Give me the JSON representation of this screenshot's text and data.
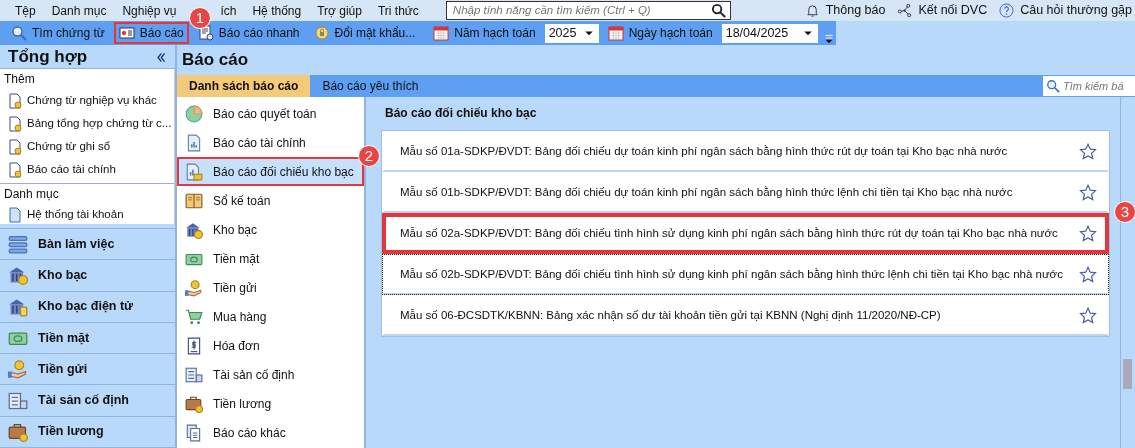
{
  "menu": [
    "Tệp",
    "Danh mục",
    "Nghiệp vụ",
    "ích",
    "Hệ thống",
    "Trợ giúp",
    "Tri thức"
  ],
  "global_search": {
    "placeholder": "Nhập tính năng cần tìm kiếm (Ctrl + Q)"
  },
  "top_links": [
    "Thông báo",
    "Kết nối DVC",
    "Câu hỏi thường gặp"
  ],
  "toolbar": {
    "buttons": [
      {
        "label": "Tìm chứng từ",
        "highlighted": false
      },
      {
        "label": "Báo cáo",
        "highlighted": true,
        "callout": "1"
      },
      {
        "label": "Báo cáo nhanh",
        "highlighted": false
      },
      {
        "label": "Đổi mật khẩu...",
        "highlighted": false
      }
    ],
    "year": {
      "label": "Năm hạch toán",
      "value": "2025"
    },
    "date": {
      "label": "Ngày hạch toán",
      "value": "18/04/2025"
    }
  },
  "sidebar": {
    "title": "Tổng hợp",
    "sections": [
      {
        "title": "Thêm",
        "items": [
          "Chứng từ nghiệp vụ khác",
          "Bảng tổng hợp chứng từ c...",
          "Chứng từ ghi sổ",
          "Báo cáo tài chính"
        ]
      },
      {
        "title": "Danh mục",
        "items": [
          "Hệ thống tài khoản"
        ]
      }
    ],
    "nav": [
      "Bàn làm việc",
      "Kho bạc",
      "Kho bạc điện tử",
      "Tiền mặt",
      "Tiền gửi",
      "Tài sản cố định",
      "Tiền lương"
    ]
  },
  "main": {
    "title": "Báo cáo",
    "tabs": [
      {
        "label": "Danh sách báo cáo",
        "selected": true
      },
      {
        "label": "Báo cáo yêu thích",
        "selected": false
      }
    ],
    "search": {
      "placeholder": "Tìm kiếm bá"
    },
    "categories": [
      {
        "label": "Báo cáo quyết toán",
        "selected": false
      },
      {
        "label": "Báo cáo tài chính",
        "selected": false
      },
      {
        "label": "Báo cáo đối chiếu kho bạc",
        "selected": true,
        "highlighted": true,
        "callout": "2"
      },
      {
        "label": "Sổ kế toán",
        "selected": false
      },
      {
        "label": "Kho bạc",
        "selected": false
      },
      {
        "label": "Tiền mặt",
        "selected": false
      },
      {
        "label": "Tiền gửi",
        "selected": false
      },
      {
        "label": "Mua hàng",
        "selected": false
      },
      {
        "label": "Hóa đơn",
        "selected": false
      },
      {
        "label": "Tài sản cố định",
        "selected": false
      },
      {
        "label": "Tiền lương",
        "selected": false
      },
      {
        "label": "Báo cáo khác",
        "selected": false
      }
    ],
    "group_title": "Báo cáo đối chiếu kho bạc",
    "reports": [
      {
        "label": "Mẫu số 01a-SDKP/ĐVDT: Bảng đối chiếu dự toán kinh phí ngân sách bằng hình thức rút dự toán tại Kho bạc nhà nước",
        "favorite": false,
        "focused": false,
        "highlighted": false
      },
      {
        "label": "Mẫu số 01b-SDKP/ĐVDT: Bảng đối chiếu dự toán kinh phí ngân sách bằng hình thức lệnh chi tiền tại Kho bạc nhà nước",
        "favorite": false,
        "focused": false,
        "highlighted": false
      },
      {
        "label": "Mẫu số 02a-SDKP/ĐVDT: Bảng đối chiếu tình hình sử dụng kinh phí ngân sách bằng hình thức rút dự toán tại Kho bạc nhà nước",
        "favorite": false,
        "focused": false,
        "highlighted": true,
        "callout": "3"
      },
      {
        "label": "Mẫu số 02b-SDKP/ĐVDT: Bảng đối chiếu tình hình sử dụng kinh phí ngân sách bằng hình thức lệnh chi tiền tại Kho bạc nhà nước",
        "favorite": false,
        "focused": true,
        "highlighted": false
      },
      {
        "label": "Mẫu số 06-ĐCSDTK/KBNN: Bảng xác nhận số dư tài khoản tiền gửi tại KBNN (Nghị định 11/2020/NĐ-CP)",
        "favorite": false,
        "focused": false,
        "highlighted": false
      }
    ]
  }
}
